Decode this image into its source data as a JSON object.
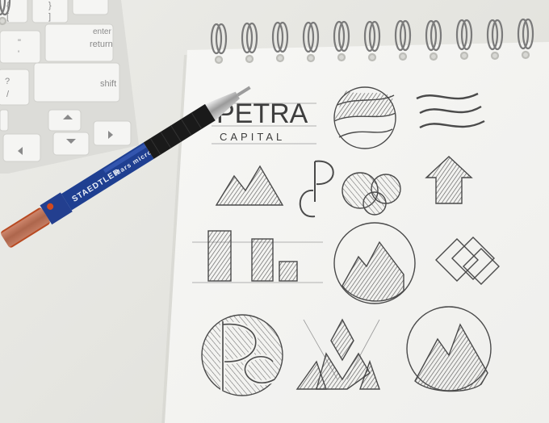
{
  "keyboard": {
    "keys": {
      "enter": "enter",
      "return": "return",
      "shift": "shift",
      "slash": "?",
      "slash_lower": "/",
      "brace_open": "{",
      "brace_open_lower": "[",
      "brace_close": "}",
      "brace_close_lower": "]",
      "quote": "\"",
      "quote_lower": "'"
    }
  },
  "pencil": {
    "brand": "STAEDTLER",
    "model": "Mars micro 0.5mm"
  },
  "sketchbook": {
    "logo_wordmark": "PETRA",
    "logo_subtitle": "CAPITAL"
  },
  "colors": {
    "paper": "#f6f6f3",
    "pencil_body": "#1f3f91",
    "pencil_grip": "#1b1b1b",
    "keyboard": "#f2f2f0",
    "graphite": "#4a4a4a"
  }
}
